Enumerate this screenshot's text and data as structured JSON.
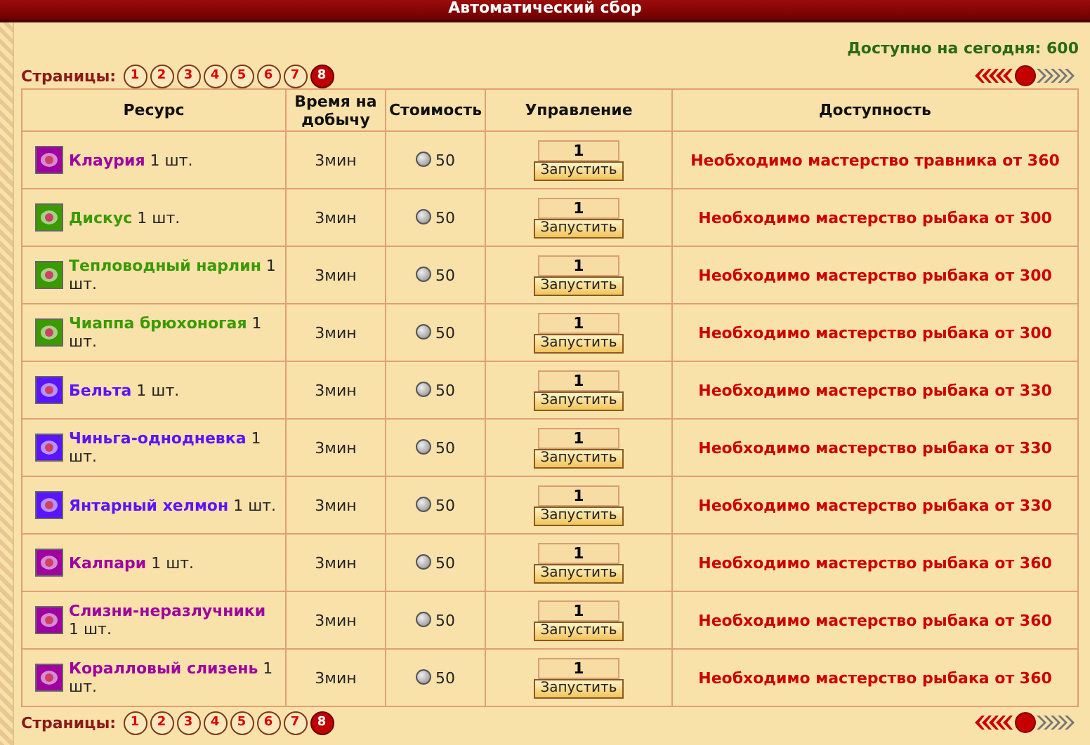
{
  "window": {
    "title": "Автоматический сбор"
  },
  "available_today": "Доступно на сегодня: 600",
  "pagination_top": {
    "label": "Страницы:",
    "pages": [
      {
        "label": "1",
        "selected": false
      },
      {
        "label": "2",
        "selected": false
      },
      {
        "label": "3",
        "selected": false
      },
      {
        "label": "4",
        "selected": false
      },
      {
        "label": "5",
        "selected": false
      },
      {
        "label": "6",
        "selected": false
      },
      {
        "label": "7",
        "selected": false
      },
      {
        "label": "8",
        "selected": true
      }
    ]
  },
  "table": {
    "columns": [
      "Ресурс",
      "Время на добычу",
      "Стоимость",
      "Управление",
      "Доступность"
    ],
    "rows": [
      {
        "name": "Клаурия",
        "quantity": "1 шт.",
        "color": "#a000a0",
        "time": "3мин",
        "cost": "50",
        "amount": "1",
        "button": "Запустить",
        "availability": "Необходимо мастерство травника от 360"
      },
      {
        "name": "Дискус",
        "quantity": "1 шт.",
        "color": "#3a9a00",
        "time": "3мин",
        "cost": "50",
        "amount": "1",
        "button": "Запустить",
        "availability": "Необходимо мастерство рыбака от 300"
      },
      {
        "name": "Тепловодный нарлин",
        "quantity": "1 шт.",
        "color": "#3a9a00",
        "time": "3мин",
        "cost": "50",
        "amount": "1",
        "button": "Запустить",
        "availability": "Необходимо мастерство рыбака от 300"
      },
      {
        "name": "Чиаппа брюхоногая",
        "quantity": "1 шт.",
        "color": "#3a9a00",
        "time": "3мин",
        "cost": "50",
        "amount": "1",
        "button": "Запустить",
        "availability": "Необходимо мастерство рыбака от 300"
      },
      {
        "name": "Бельта",
        "quantity": "1 шт.",
        "color": "#5a14ff",
        "time": "3мин",
        "cost": "50",
        "amount": "1",
        "button": "Запустить",
        "availability": "Необходимо мастерство рыбака от 330"
      },
      {
        "name": "Чиньга-однодневка",
        "quantity": "1 шт.",
        "color": "#5a14ff",
        "time": "3мин",
        "cost": "50",
        "amount": "1",
        "button": "Запустить",
        "availability": "Необходимо мастерство рыбака от 330"
      },
      {
        "name": "Янтарный хелмон",
        "quantity": "1 шт.",
        "color": "#5a14ff",
        "time": "3мин",
        "cost": "50",
        "amount": "1",
        "button": "Запустить",
        "availability": "Необходимо мастерство рыбака от 330"
      },
      {
        "name": "Калпари",
        "quantity": "1 шт.",
        "color": "#a000a0",
        "time": "3мин",
        "cost": "50",
        "amount": "1",
        "button": "Запустить",
        "availability": "Необходимо мастерство рыбака от 360"
      },
      {
        "name": "Слизни-неразлучники",
        "quantity": "1 шт.",
        "color": "#a000a0",
        "time": "3мин",
        "cost": "50",
        "amount": "1",
        "button": "Запустить",
        "availability": "Необходимо мастерство рыбака от 360"
      },
      {
        "name": "Коралловый слизень",
        "quantity": "1 шт.",
        "color": "#a000a0",
        "time": "3мин",
        "cost": "50",
        "amount": "1",
        "button": "Запустить",
        "availability": "Необходимо мастерство рыбака от 360"
      }
    ]
  },
  "pagination_bottom": {
    "label": "Страницы:",
    "pages": [
      {
        "label": "1",
        "selected": false
      },
      {
        "label": "2",
        "selected": false
      },
      {
        "label": "3",
        "selected": false
      },
      {
        "label": "4",
        "selected": false
      },
      {
        "label": "5",
        "selected": false
      },
      {
        "label": "6",
        "selected": false
      },
      {
        "label": "7",
        "selected": false
      },
      {
        "label": "8",
        "selected": true
      }
    ]
  }
}
